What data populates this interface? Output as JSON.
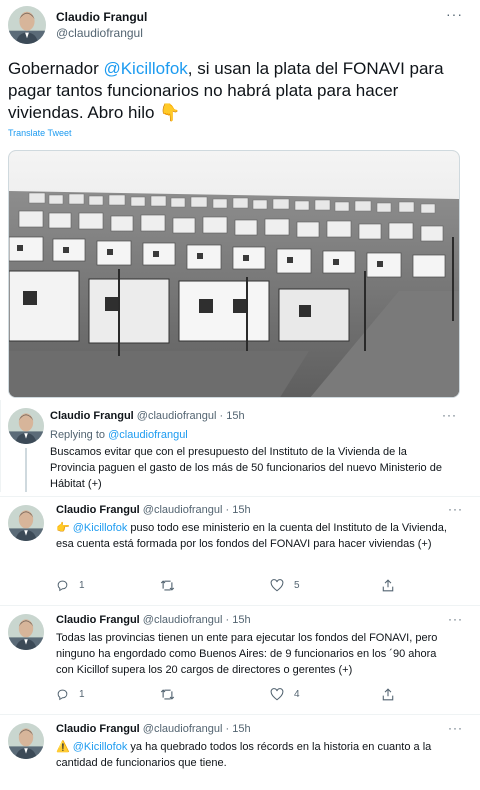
{
  "main_tweet": {
    "author_name": "Claudio Frangul",
    "author_handle": "@claudiofrangul",
    "text_before": "Gobernador ",
    "mention": "@Kicillofok",
    "text_after": ", si usan la plata del FONAVI para pagar tantos funcionarios no habrá plata para hacer viviendas. Abro hilo ",
    "emoji": "👇",
    "translate_label": "Translate Tweet"
  },
  "replies": [
    {
      "author_name": "Claudio Frangul",
      "author_handle": "@claudiofrangul",
      "time": "· 15h",
      "replying_prefix": "Replying to ",
      "replying_to": "@claudiofrangul",
      "text": "Buscamos evitar que con el presupuesto del Instituto de la Vivienda de la Provincia paguen el gasto de los más de 50 funcionarios del nuevo Ministerio de Hábitat (+)"
    },
    {
      "author_name": "Claudio Frangul",
      "author_handle": "@claudiofrangul",
      "time": "· 15h",
      "emoji": "👉",
      "mention": "@Kicillofok",
      "text": " puso todo ese ministerio en la cuenta del Instituto de la Vivienda, esa cuenta está formada por los fondos del FONAVI para hacer viviendas (+)",
      "reply_count": "1",
      "like_count": "5"
    },
    {
      "author_name": "Claudio Frangul",
      "author_handle": "@claudiofrangul",
      "time": "· 15h",
      "text": "Todas las provincias tienen un ente para ejecutar los fondos del FONAVI, pero ninguno ha engordado como Buenos Aires: de 9 funcionarios en los ´90  ahora con Kicillof supera los 20 cargos de directores o gerentes (+)",
      "reply_count": "1",
      "like_count": "4"
    },
    {
      "author_name": "Claudio Frangul",
      "author_handle": "@claudiofrangul",
      "time": "· 15h",
      "emoji": "⚠️",
      "mention": "@Kicillofok",
      "text": " ya ha quebrado todos los récords en la historia en cuanto a la cantidad de funcionarios que tiene."
    }
  ],
  "more_icon": "···",
  "colors": {
    "link": "#1d9bf0",
    "muted": "#536471",
    "border": "#cfd9de"
  }
}
